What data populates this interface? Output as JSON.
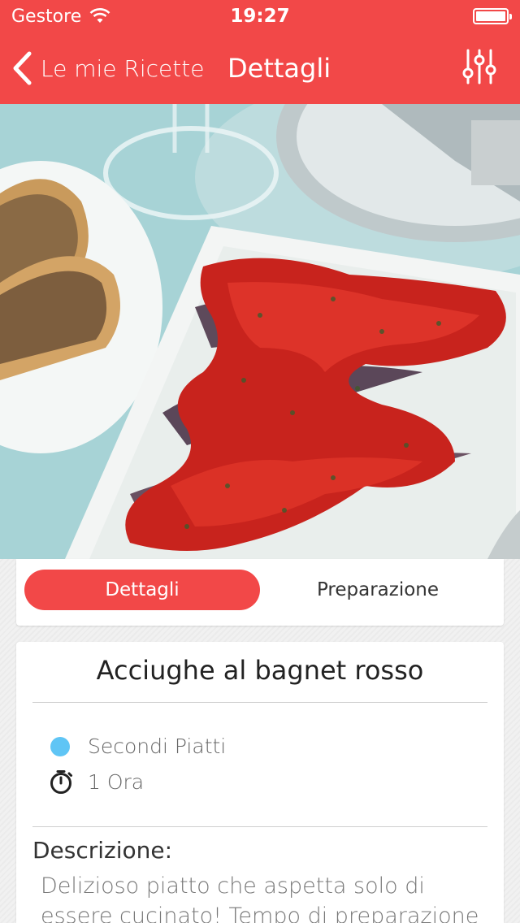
{
  "status_bar": {
    "carrier": "Gestore",
    "time": "19:27"
  },
  "nav": {
    "back_label": "Le mie Ricette",
    "title": "Dettagli"
  },
  "tabs": [
    {
      "label": "Dettagli",
      "active": true
    },
    {
      "label": "Preparazione",
      "active": false
    }
  ],
  "recipe": {
    "title": "Acciughe al bagnet rosso",
    "category": "Secondi Piatti",
    "category_color": "#5fc5f5",
    "duration": "1 Ora",
    "description_heading": "Descrizione:",
    "description": "Delizioso piatto che aspetta solo di essere cucinato! Tempo di preparazione"
  },
  "colors": {
    "accent": "#f24848"
  }
}
